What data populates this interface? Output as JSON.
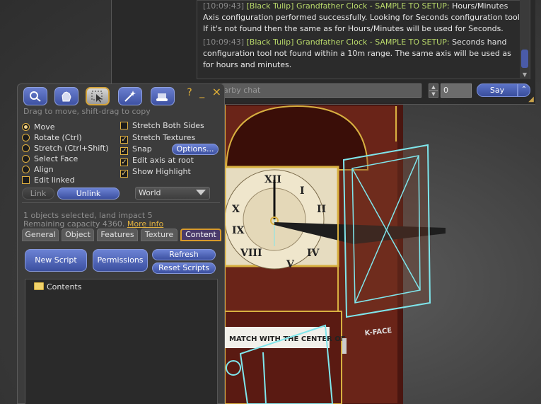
{
  "chat": {
    "messages": [
      {
        "time": "",
        "from": "",
        "text": "Hours/Minutes Axis configuration performed successfully. Looking for Seconds configuration tool. If it's not found then the same as for Hours/Minutes will be used for Seconds."
      },
      {
        "time": "[10:09:43]",
        "from": "[Black Tulip] Grandfather Clock - SAMPLE TO SETUP:",
        "text": "Seconds hand configuration tool not found within a 10m range. The same axis will be used as for hours and minutes."
      }
    ],
    "first_line_time": "[10:09:43]",
    "first_line_from": "[Black Tulip] Grandfather Clock - SAMPLE TO SETUP:",
    "input_placeholder": "Nearby chat",
    "input_visible": "arby chat",
    "channel": "0",
    "say_label": "Say"
  },
  "build": {
    "title_buttons": [
      "?",
      "_",
      "×"
    ],
    "hint": "Drag to move, shift-drag to copy",
    "modes": [
      {
        "label": "Move",
        "selected": true
      },
      {
        "label": "Rotate (Ctrl)",
        "selected": false
      },
      {
        "label": "Stretch (Ctrl+Shift)",
        "selected": false
      },
      {
        "label": "Select Face",
        "selected": false
      },
      {
        "label": "Align",
        "selected": false
      }
    ],
    "edit_linked": {
      "label": "Edit linked",
      "checked": false
    },
    "options": [
      {
        "label": "Stretch Both Sides",
        "checked": false
      },
      {
        "label": "Stretch Textures",
        "checked": true
      },
      {
        "label": "Snap",
        "checked": true
      },
      {
        "label": "Edit axis at root",
        "checked": true
      },
      {
        "label": "Show Highlight",
        "checked": true
      }
    ],
    "options_button": "Options...",
    "link_label": "Link",
    "unlink_label": "Unlink",
    "ruler_value": "World",
    "selected_info": "1 objects selected, land impact 5",
    "capacity_info": "Remaining capacity 4360.",
    "more_info": "More info",
    "tabs": [
      "General",
      "Object",
      "Features",
      "Texture",
      "Content"
    ],
    "active_tab": "Content",
    "new_script": "New Script",
    "permissions": "Permissions",
    "refresh": "Refresh",
    "reset_scripts": "Reset Scripts",
    "contents_folder": "Contents"
  },
  "scene": {
    "sign_text": "MATCH WITH THE CENTER OF",
    "sign_text_2": "K-FACE",
    "highlight_color": "#7fe6ec",
    "wood_color": "#5a1a12",
    "trim_color": "#d8b040"
  }
}
